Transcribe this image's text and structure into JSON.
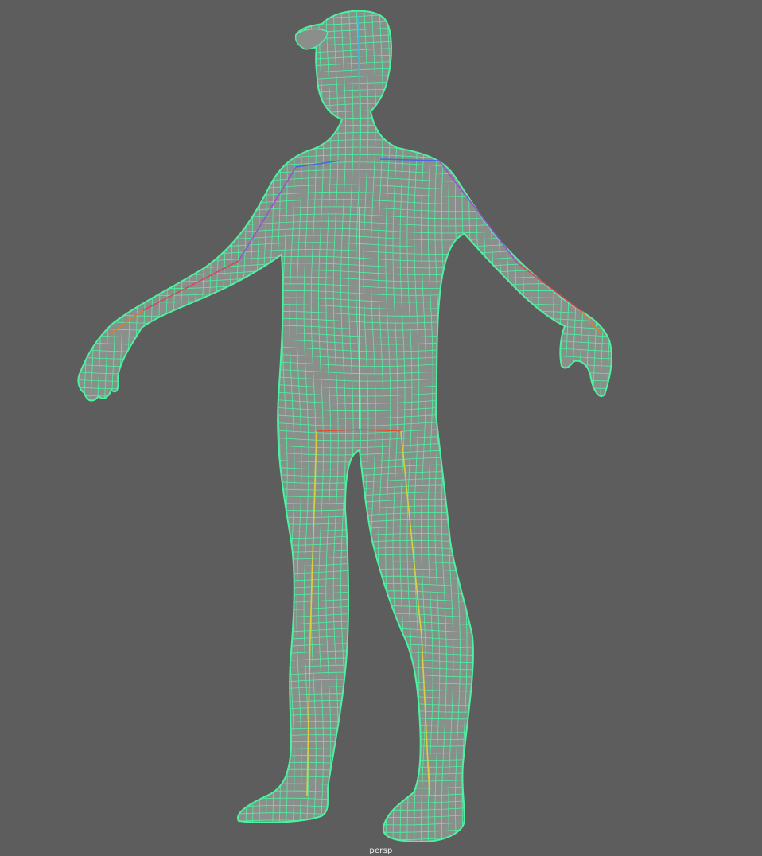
{
  "viewport": {
    "camera_name": "persp",
    "background_color": "#5d5d5d"
  },
  "model": {
    "wireframe_color": "#4cf2a0",
    "fill_color": "#8a8f8c",
    "joint_colors": {
      "spine": "#e8d84a",
      "neck": "#3fb8d8",
      "clavicle": "#4a68e0",
      "upper_arm": "#9a50d0",
      "forearm": "#e04060",
      "hand": "#e07a30",
      "hip": "#e05030",
      "leg": "#d8d040"
    }
  }
}
